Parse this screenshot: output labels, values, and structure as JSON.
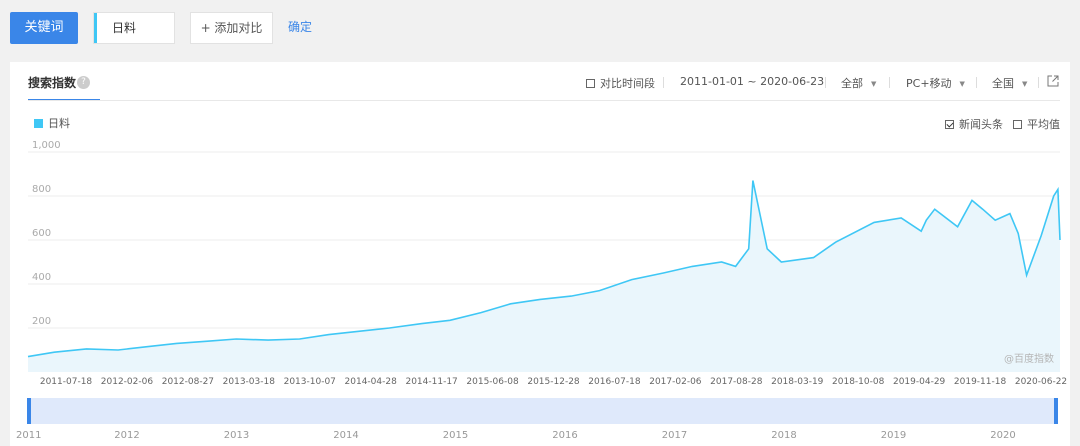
{
  "topbar": {
    "keyword_button": "关键词",
    "keyword_value": "日料",
    "add_compare": "+ 添加对比",
    "confirm": "确定"
  },
  "panel": {
    "title": "搜索指数",
    "help_icon": "question-icon",
    "compare_period": "对比时间段",
    "date_range": "2011-01-01 ~ 2020-06-23",
    "region_scope": "全部",
    "device": "PC+移动",
    "area": "全国",
    "export_icon": "external-link-icon",
    "legend_label": "日料",
    "news_toggle": "新闻头条",
    "news_checked": true,
    "average_toggle": "平均值",
    "average_checked": false,
    "watermark": "@百度指数",
    "colors": {
      "series": "#3fc7f5",
      "fill": "#eaf6fc",
      "accent": "#3a86e8"
    }
  },
  "chart_data": {
    "type": "area",
    "title": "",
    "ylim": [
      0,
      1000
    ],
    "yticks": [
      "200",
      "400",
      "600",
      "800",
      "1,000"
    ],
    "x_tick_labels": [
      "2011-07-18",
      "2012-02-06",
      "2012-08-27",
      "2013-03-18",
      "2013-10-07",
      "2014-04-28",
      "2014-11-17",
      "2015-06-08",
      "2015-12-28",
      "2016-07-18",
      "2017-02-06",
      "2017-08-28",
      "2018-03-19",
      "2018-10-08",
      "2019-04-29",
      "2019-11-18",
      "2020-06-22"
    ],
    "series": [
      {
        "name": "日料",
        "x": [
          "2011-01-03",
          "2011-04-01",
          "2011-07-18",
          "2011-11-01",
          "2012-02-06",
          "2012-05-15",
          "2012-08-27",
          "2012-12-01",
          "2013-03-18",
          "2013-07-01",
          "2013-10-07",
          "2014-01-15",
          "2014-04-28",
          "2014-08-15",
          "2014-11-17",
          "2015-03-01",
          "2015-06-08",
          "2015-09-15",
          "2015-12-28",
          "2016-04-01",
          "2016-07-18",
          "2016-11-01",
          "2017-02-06",
          "2017-05-15",
          "2017-07-01",
          "2017-08-14",
          "2017-08-28",
          "2017-10-15",
          "2017-12-01",
          "2018-03-19",
          "2018-06-01",
          "2018-10-08",
          "2019-01-07",
          "2019-03-15",
          "2019-04-01",
          "2019-04-29",
          "2019-07-15",
          "2019-09-01",
          "2019-10-07",
          "2019-11-18",
          "2020-01-06",
          "2020-02-03",
          "2020-03-02",
          "2020-04-20",
          "2020-06-01",
          "2020-06-15",
          "2020-06-22"
        ],
        "values": [
          70,
          90,
          105,
          100,
          115,
          130,
          140,
          150,
          145,
          150,
          170,
          185,
          200,
          220,
          235,
          270,
          310,
          330,
          345,
          370,
          420,
          450,
          480,
          500,
          480,
          560,
          870,
          560,
          500,
          520,
          590,
          680,
          700,
          640,
          690,
          740,
          660,
          780,
          740,
          690,
          720,
          630,
          440,
          620,
          800,
          830,
          600
        ]
      }
    ]
  },
  "timeline": {
    "years": [
      "2011",
      "2012",
      "2013",
      "2014",
      "2015",
      "2016",
      "2017",
      "2018",
      "2019",
      "2020"
    ]
  }
}
